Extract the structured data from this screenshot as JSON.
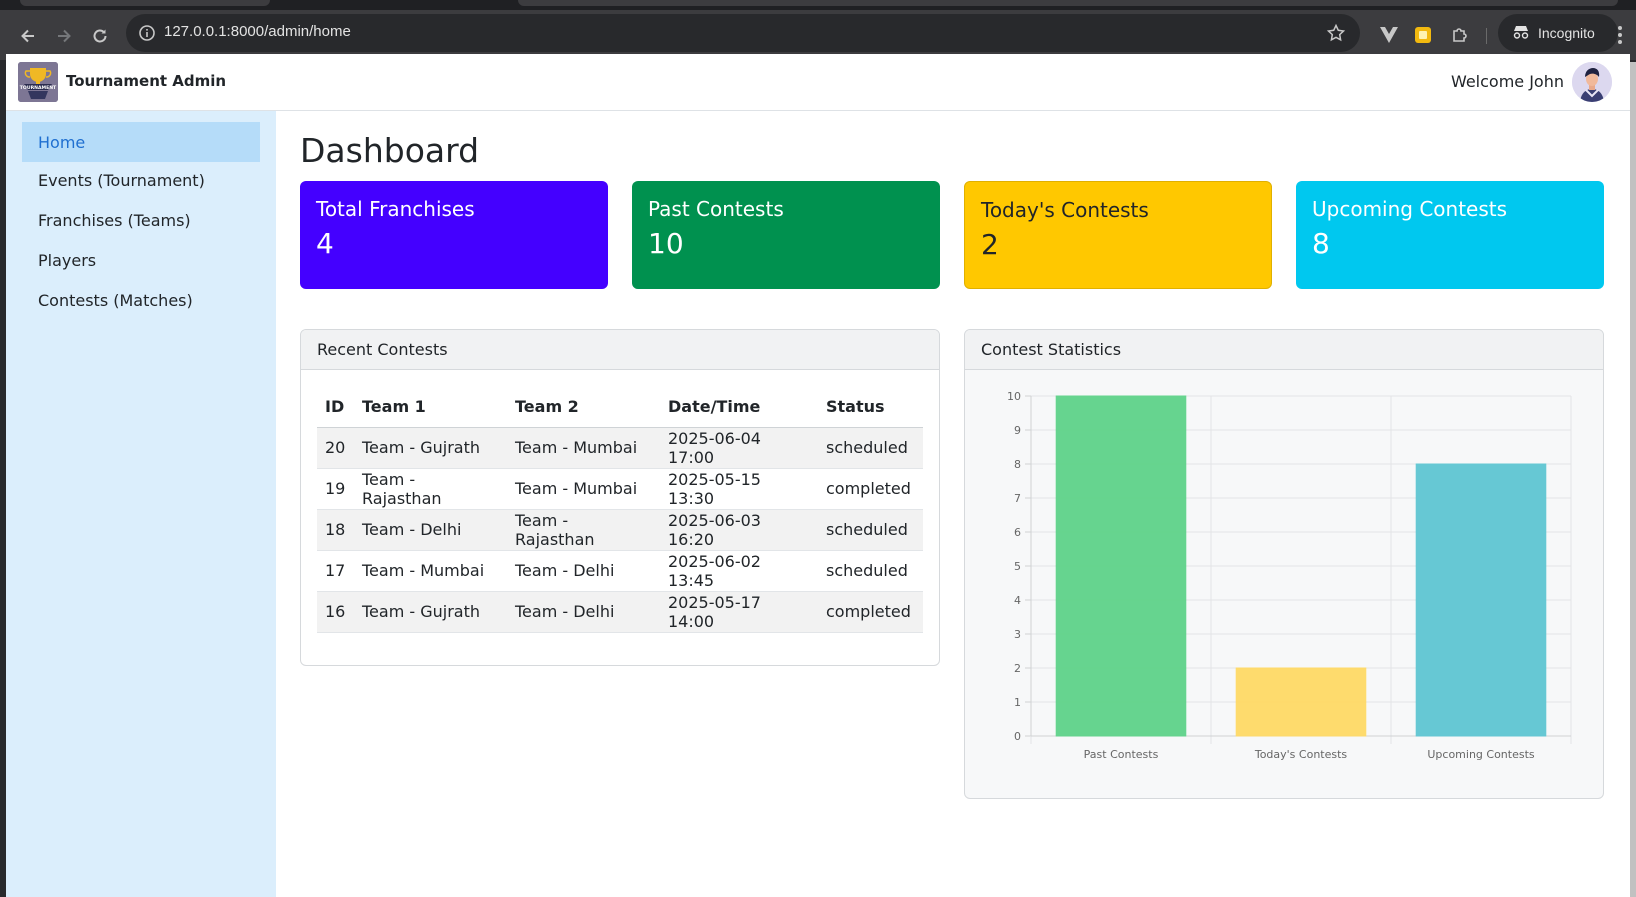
{
  "browser": {
    "url": "127.0.0.1:8000/admin/home",
    "incognito_label": "Incognito"
  },
  "topbar": {
    "brand": "Tournament Admin",
    "logo_text": "TOURNAMENT",
    "welcome": "Welcome John"
  },
  "sidebar": {
    "items": [
      {
        "label": "Home",
        "active": true
      },
      {
        "label": "Events (Tournament)"
      },
      {
        "label": "Franchises (Teams)"
      },
      {
        "label": "Players"
      },
      {
        "label": "Contests (Matches)"
      }
    ]
  },
  "main": {
    "title": "Dashboard",
    "cards": [
      {
        "label": "Total Franchises",
        "value": "4",
        "color": "#4400ff"
      },
      {
        "label": "Past Contests",
        "value": "10",
        "color": "#00914f"
      },
      {
        "label": "Today's Contests",
        "value": "2",
        "color": "#ffc800"
      },
      {
        "label": "Upcoming Contests",
        "value": "8",
        "color": "#00c8ef"
      }
    ],
    "recent": {
      "title": "Recent Contests",
      "headers": [
        "ID",
        "Team 1",
        "Team 2",
        "Date/Time",
        "Status"
      ],
      "rows": [
        [
          "20",
          "Team - Gujrath",
          "Team - Mumbai",
          "2025-06-04 17:00",
          "scheduled"
        ],
        [
          "19",
          "Team - Rajasthan",
          "Team - Mumbai",
          "2025-05-15 13:30",
          "completed"
        ],
        [
          "18",
          "Team - Delhi",
          "Team - Rajasthan",
          "2025-06-03 16:20",
          "scheduled"
        ],
        [
          "17",
          "Team - Mumbai",
          "Team - Delhi",
          "2025-06-02 13:45",
          "scheduled"
        ],
        [
          "16",
          "Team - Gujrath",
          "Team - Delhi",
          "2025-05-17 14:00",
          "completed"
        ]
      ]
    },
    "stats_title": "Contest Statistics"
  },
  "chart_data": {
    "type": "bar",
    "categories": [
      "Past Contests",
      "Today's Contests",
      "Upcoming Contests"
    ],
    "values": [
      10,
      2,
      8
    ],
    "colors": [
      "#5fd38a",
      "#ffda66",
      "#5fc6d3"
    ],
    "ylim": [
      0,
      10
    ],
    "yticks": [
      0,
      1,
      2,
      3,
      4,
      5,
      6,
      7,
      8,
      9,
      10
    ],
    "grid": true,
    "legend": "none"
  }
}
